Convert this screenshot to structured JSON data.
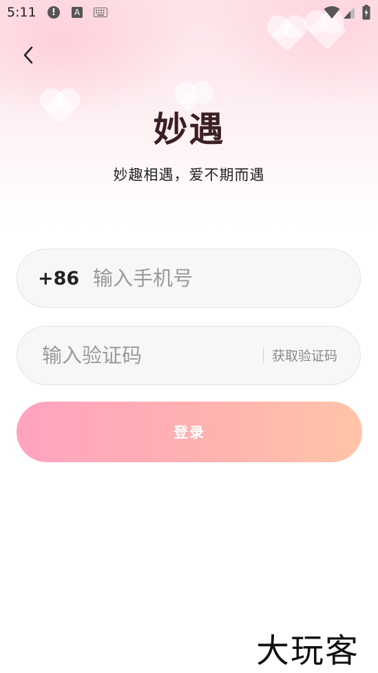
{
  "status_bar": {
    "time": "5:11",
    "icons": [
      "alert-icon",
      "a-icon",
      "keyboard-icon",
      "wifi-icon",
      "signal-icon",
      "battery-icon"
    ]
  },
  "header": {
    "back_icon": "chevron-left-icon"
  },
  "brand": {
    "title": "妙遇",
    "tagline": "妙趣相遇，爱不期而遇"
  },
  "phone": {
    "country_code": "+86",
    "placeholder": "输入手机号",
    "value": ""
  },
  "code": {
    "placeholder": "输入验证码",
    "value": "",
    "get_code_label": "获取验证码"
  },
  "login": {
    "label": "登录"
  },
  "watermark": {
    "text": "大玩客"
  },
  "colors": {
    "login_gradient_start": "#ffa3c0",
    "login_gradient_end": "#ffc4a8",
    "brand_text": "#3b1f24",
    "placeholder": "#9a9a9a",
    "field_background": "#f7f7f7"
  }
}
